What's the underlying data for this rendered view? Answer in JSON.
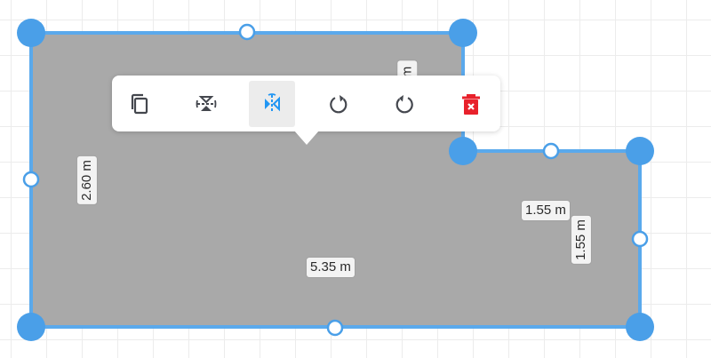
{
  "dimensions": {
    "height_left": "2.60 m",
    "width_bottom": "5.35 m",
    "notch_horizontal": "1.55 m",
    "notch_vertical": "1.55 m",
    "top_right_partial": "m"
  },
  "toolbar": {
    "items": [
      {
        "name": "duplicate",
        "icon": "copy-icon",
        "active": false
      },
      {
        "name": "flip-vertical",
        "icon": "flip-vertical-icon",
        "active": false
      },
      {
        "name": "flip-horizontal",
        "icon": "flip-horizontal-icon",
        "active": true
      },
      {
        "name": "rotate-counterclockwise",
        "icon": "rotate-left-icon",
        "active": false
      },
      {
        "name": "rotate-clockwise",
        "icon": "rotate-right-icon",
        "active": false
      },
      {
        "name": "delete",
        "icon": "trash-icon",
        "active": false
      }
    ]
  },
  "colors": {
    "shape_fill": "#a9a9a9",
    "outline": "#5aa9ec",
    "handle": "#4a9fe8",
    "icon": "#44474e",
    "icon_active": "#2196f3",
    "delete": "#e8212b"
  }
}
